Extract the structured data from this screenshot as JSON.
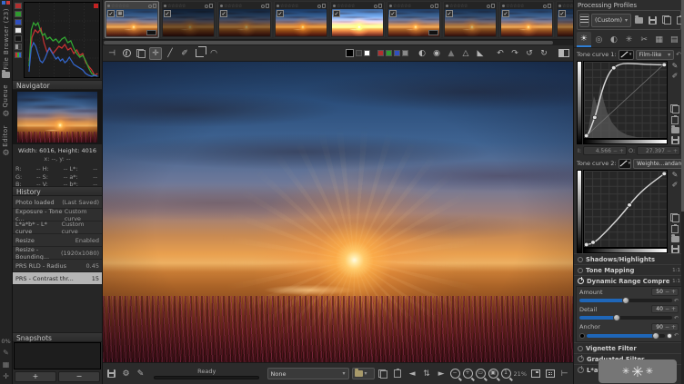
{
  "steppers": {
    "minus": "−",
    "plus": "+"
  },
  "rail": {
    "tabs": [
      {
        "label": "File Browser (23)"
      },
      {
        "label": "Queue"
      },
      {
        "label": "Editor"
      }
    ],
    "progress_label": "0%"
  },
  "navigator": {
    "title": "Navigator",
    "dimensions": "Width: 6016, Height: 4016",
    "cursor": "x: --, y: --",
    "readouts": [
      [
        "R:",
        "--",
        "H:",
        "--",
        "L*:",
        "--"
      ],
      [
        "G:",
        "--",
        "S:",
        "--",
        "a*:",
        "--"
      ],
      [
        "B:",
        "--",
        "V:",
        "--",
        "b*:",
        "--"
      ]
    ]
  },
  "history": {
    "title": "History",
    "selected_index": 6,
    "rows": [
      {
        "name": "Photo loaded",
        "value": "(Last Saved)"
      },
      {
        "name": "Exposure - Tone c...",
        "value": "Custom curve"
      },
      {
        "name": "L*a*b* - L* curve",
        "value": "Custom curve"
      },
      {
        "name": "Resize",
        "value": "Enabled"
      },
      {
        "name": "Resize - Bounding...",
        "value": "(1920x1080)"
      },
      {
        "name": "PRS RLD - Radius",
        "value": "0.45"
      },
      {
        "name": "PRS - Contrast thr...",
        "value": "15"
      }
    ]
  },
  "snapshots": {
    "title": "Snapshots",
    "add_label": "+",
    "remove_label": "−"
  },
  "statusbar": {
    "status": "Ready",
    "profile": "None",
    "zoom": "21%"
  },
  "right_panel": {
    "title": "Processing Profiles",
    "profile": "(Custom)",
    "tone_curve_1": {
      "label": "Tone curve 1:",
      "mode": "Film-like"
    },
    "curve_io": {
      "in_label": "I:",
      "in_value": "4.566",
      "out_label": "O:",
      "out_value": "27.397"
    },
    "tone_curve_2": {
      "label": "Tone curve 2:",
      "mode": "Weighte...andard"
    },
    "sections": [
      {
        "label": "Shadows/Highlights",
        "badge": ""
      },
      {
        "label": "Tone Mapping",
        "badge": "1:1"
      },
      {
        "label": "Dynamic Range Compression",
        "badge": "1:1"
      }
    ],
    "drc": {
      "sliders": [
        {
          "label": "Amount",
          "value": "50",
          "pct": 50
        },
        {
          "label": "Detail",
          "value": "40",
          "pct": 40
        },
        {
          "label": "Anchor",
          "value": "90",
          "pct": 88
        }
      ]
    },
    "sections_lower": [
      {
        "label": "Vignette Filter"
      },
      {
        "label": "Graduated Filter"
      },
      {
        "label": "L*a*b* Adjustments"
      }
    ]
  }
}
